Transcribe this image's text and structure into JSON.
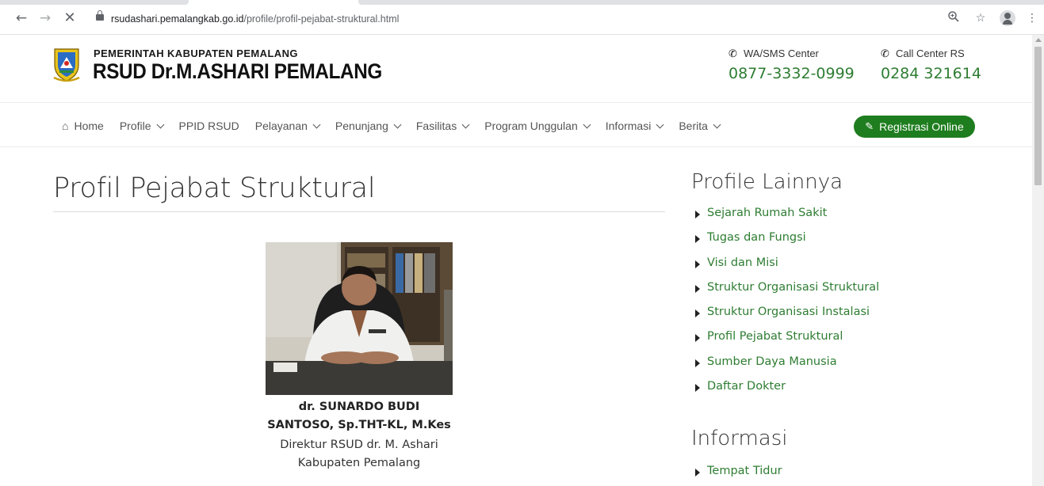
{
  "browser": {
    "url_host": "rsudashari.pemalangkab.go.id",
    "url_path": "/profile/profil-pejabat-struktural.html",
    "icons": [
      "back-icon",
      "forward-icon",
      "stop-icon",
      "lock-icon",
      "zoom-icon",
      "star-icon",
      "profile-icon",
      "menu-icon"
    ]
  },
  "header": {
    "brand_top": "PEMERINTAH KABUPATEN PEMALANG",
    "brand_main": "RSUD Dr.M.ASHARI PEMALANG",
    "wa_label": "WA/SMS Center",
    "wa_number": "0877-3332-0999",
    "call_label": "Call Center RS",
    "call_number": "0284 321614"
  },
  "nav": {
    "items": [
      {
        "label": "Home",
        "dropdown": false
      },
      {
        "label": "Profile",
        "dropdown": true
      },
      {
        "label": "PPID RSUD",
        "dropdown": false
      },
      {
        "label": "Pelayanan",
        "dropdown": true
      },
      {
        "label": "Penunjang",
        "dropdown": true
      },
      {
        "label": "Fasilitas",
        "dropdown": true
      },
      {
        "label": "Program Unggulan",
        "dropdown": true
      },
      {
        "label": "Informasi",
        "dropdown": true
      },
      {
        "label": "Berita",
        "dropdown": true
      }
    ],
    "register_label": "Registrasi Online"
  },
  "main": {
    "title": "Profil Pejabat Struktural",
    "person_name_line1": "dr. SUNARDO BUDI",
    "person_name_line2": "SANTOSO, Sp.THT-KL, M.Kes",
    "person_title_line1": "Direktur RSUD dr. M. Ashari",
    "person_title_line2": "Kabupaten Pemalang"
  },
  "sidebar": {
    "profile_heading": "Profile Lainnya",
    "profile_links": [
      "Sejarah Rumah Sakit",
      "Tugas dan Fungsi",
      "Visi dan Misi",
      "Struktur Organisasi Struktural",
      "Struktur Organisasi Instalasi",
      "Profil Pejabat Struktural",
      "Sumber Daya Manusia",
      "Daftar Dokter"
    ],
    "info_heading": "Informasi",
    "info_links": [
      "Tempat Tidur"
    ]
  },
  "colors": {
    "accent_green": "#2e7d32",
    "button_green": "#1e7d1e"
  }
}
